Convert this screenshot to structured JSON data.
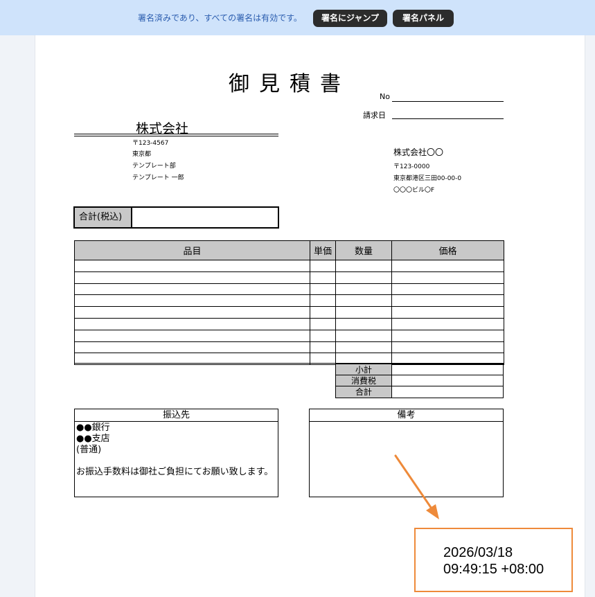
{
  "signature_bar": {
    "message": "署名済みであり、すべての署名は有効です。",
    "jump_label": "署名にジャンプ",
    "panel_label": "署名パネル"
  },
  "doc": {
    "title": "御見積書",
    "no_label": "No",
    "billing_date_label": "請求日",
    "client": {
      "name": "株式会社",
      "postal": "〒123-4567",
      "city": "東京都",
      "dept": "テンプレート部",
      "person": "テンプレート 一郎"
    },
    "issuer": {
      "name": "株式会社〇〇",
      "postal": "〒123-0000",
      "address": "東京都港区三田00-00-0",
      "building": "〇〇〇ビル〇F"
    },
    "total_label": "合計(税込)",
    "table": {
      "headers": [
        "品目",
        "単価",
        "数量",
        "価格"
      ],
      "row_count": 9
    },
    "subtotal_label": "小計",
    "tax_label": "消費税",
    "sum_label": "合計",
    "transfer": {
      "header": "振込先",
      "bank": "●●銀行",
      "branch": "●●支店",
      "account_type": "(普通)",
      "note": "お振込手数料は御社ご負担にてお願い致します。"
    },
    "remarks_header": "備考"
  },
  "stamp": {
    "date": "2026/03/18",
    "time": "09:49:15 +08:00",
    "border_color": "#ee8a3a"
  }
}
